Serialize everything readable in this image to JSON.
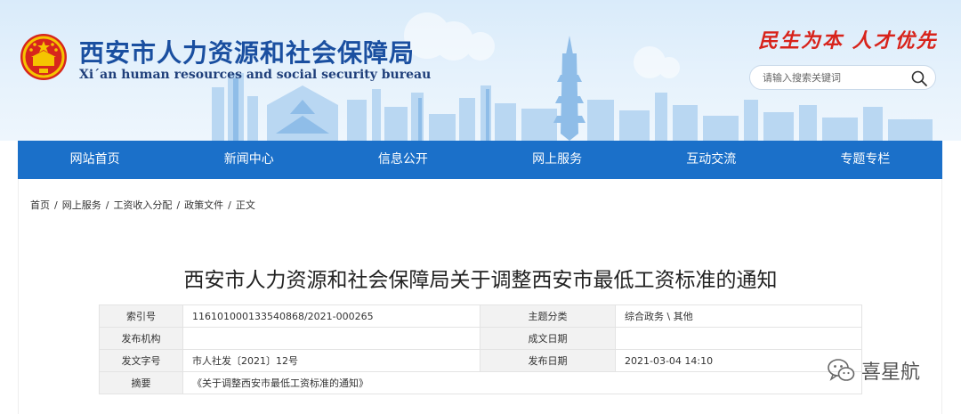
{
  "header": {
    "title": "西安市人力资源和社会保障局",
    "subtitle": "Xi´an human resources and social security bureau",
    "slogan": "民生为本 人才优先",
    "search": {
      "placeholder": "请输入搜索关键词",
      "value": ""
    },
    "icons": {
      "emblem": "national-emblem-icon",
      "search": "search-icon"
    },
    "colors": {
      "title": "#1a4fa0",
      "slogan": "#d8231b"
    }
  },
  "nav": {
    "items": [
      "网站首页",
      "新闻中心",
      "信息公开",
      "网上服务",
      "互动交流",
      "专题专栏"
    ],
    "color": "#1b70c9"
  },
  "breadcrumb": {
    "items": [
      "首页",
      "网上服务",
      "工资收入分配",
      "政策文件",
      "正文"
    ],
    "separator": "/"
  },
  "article": {
    "title": "西安市人力资源和社会保障局关于调整西安市最低工资标准的通知",
    "meta": {
      "index_label": "索引号",
      "index_value": "116101000133540868/2021-000265",
      "category_label": "主题分类",
      "category_value": "综合政务 \\ 其他",
      "issuer_label": "发布机构",
      "issuer_value": "",
      "created_label": "成文日期",
      "created_value": "",
      "docno_label": "发文字号",
      "docno_value": "市人社发〔2021〕12号",
      "published_label": "发布日期",
      "published_value": "2021-03-04 14:10",
      "abstract_label": "摘要",
      "abstract_value": "《关于调整西安市最低工资标准的通知》"
    }
  },
  "watermark": {
    "text": "喜星航",
    "icon": "wechat-icon"
  }
}
